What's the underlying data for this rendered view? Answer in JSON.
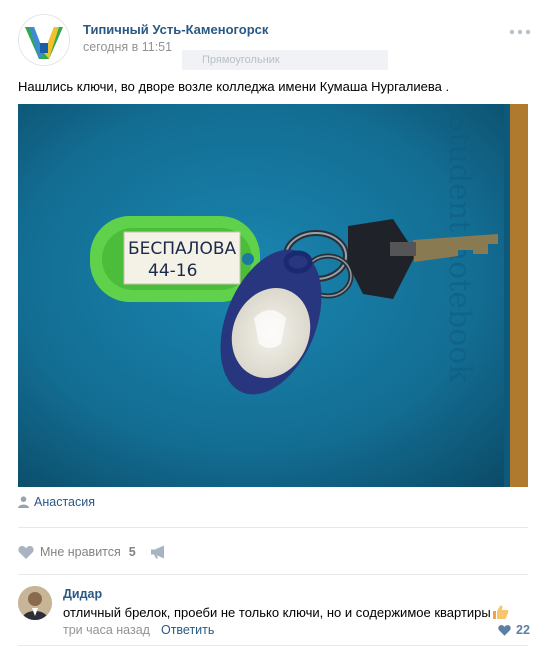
{
  "post": {
    "group_name": "Типичный Усть-Каменогорск",
    "time": "сегодня в 11:51",
    "tooltip": "Прямоугольник",
    "text": "Нашлись ключи, во дворе возле колледжа имени Кумаша Нургалиева .",
    "photo": {
      "tag_line1": "БЕСПАЛОВА",
      "tag_line2": "44-16",
      "notebook_text": "Student notebook"
    },
    "author": "Анастасия"
  },
  "actions": {
    "like_label": "Мне нравится",
    "like_count": "5"
  },
  "comment": {
    "author": "Дидар",
    "text": "отличный брелок, проеби не только ключи, но и содержимое квартиры",
    "time": "три часа назад",
    "reply_label": "Ответить",
    "like_count": "22"
  },
  "colors": {
    "link": "#2a5885",
    "muted": "#939393",
    "divider": "#e7e8ec",
    "photo_bg": "#13739a"
  },
  "icons": {
    "more": "more-dots-icon",
    "author": "user-icon",
    "like": "heart-icon",
    "share": "megaphone-icon",
    "emoji": "thumbs-up-emoji"
  }
}
